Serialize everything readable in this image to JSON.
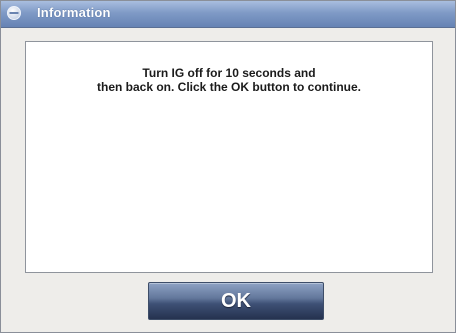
{
  "dialog": {
    "title": "Information",
    "title_icon": "circle-info-icon",
    "message_lines": [
      "Turn IG off for 10 seconds and",
      "then back on. Click the OK button to continue."
    ],
    "ok_label": "OK"
  },
  "colors": {
    "titlebar": "#7f9ac6",
    "window_bg": "#eeedea",
    "panel_bg": "#ffffff",
    "button": "#3e5075"
  }
}
